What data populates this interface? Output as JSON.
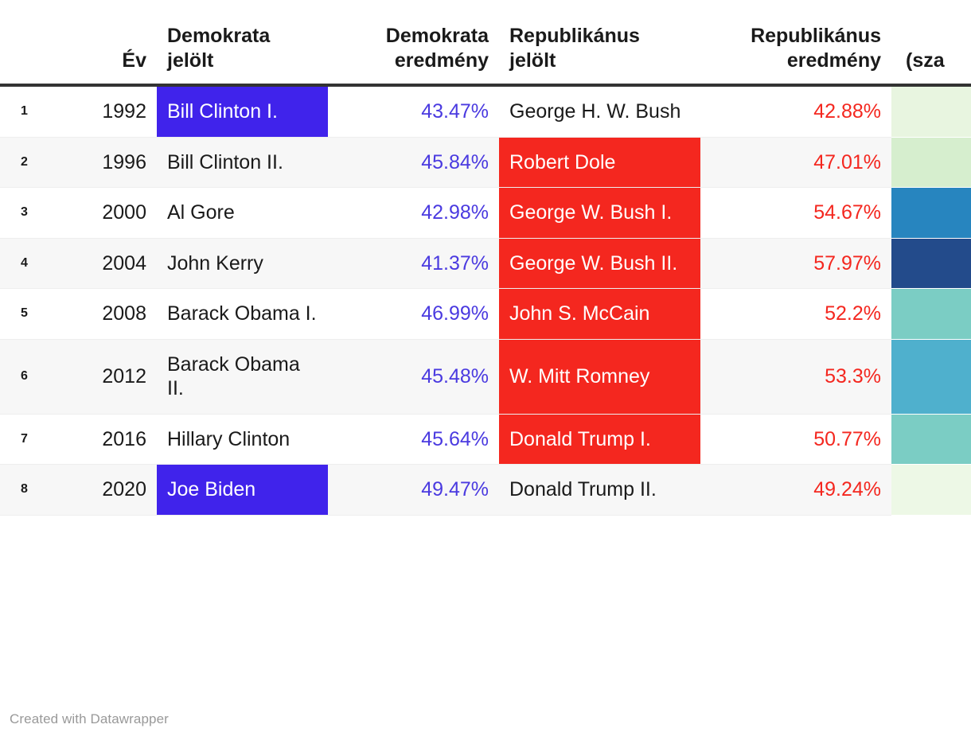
{
  "chart_data": {
    "type": "table",
    "title": "",
    "columns": [
      {
        "key": "index",
        "label": "",
        "align": "left"
      },
      {
        "key": "year",
        "label": "Év",
        "align": "right"
      },
      {
        "key": "dem_cand",
        "label": "Demokrata jelölt",
        "align": "left"
      },
      {
        "key": "dem_result",
        "label": "Demokrata eredmény",
        "align": "right"
      },
      {
        "key": "rep_cand",
        "label": "Republikánus jelölt",
        "align": "left"
      },
      {
        "key": "rep_result",
        "label": "Republikánus eredmény",
        "align": "right"
      },
      {
        "key": "swatch",
        "label": "(sza",
        "align": "left"
      }
    ],
    "rows": [
      {
        "index": "1",
        "year": "1992",
        "dem_cand": "Bill Clinton I.",
        "dem_result": "43.47%",
        "rep_cand": "George H. W. Bush",
        "rep_result": "42.88%",
        "dem_highlight": true,
        "rep_highlight": false,
        "swatch_color": "#e8f5e0"
      },
      {
        "index": "2",
        "year": "1996",
        "dem_cand": "Bill Clinton II.",
        "dem_result": "45.84%",
        "rep_cand": "Robert Dole",
        "rep_result": "47.01%",
        "dem_highlight": false,
        "rep_highlight": true,
        "swatch_color": "#d6eece"
      },
      {
        "index": "3",
        "year": "2000",
        "dem_cand": "Al Gore",
        "dem_result": "42.98%",
        "rep_cand": "George W. Bush I.",
        "rep_result": "54.67%",
        "dem_highlight": false,
        "rep_highlight": true,
        "swatch_color": "#2785bf"
      },
      {
        "index": "4",
        "year": "2004",
        "dem_cand": "John Kerry",
        "dem_result": "41.37%",
        "rep_cand": "George W. Bush II.",
        "rep_result": "57.97%",
        "dem_highlight": false,
        "rep_highlight": true,
        "swatch_color": "#234b8b"
      },
      {
        "index": "5",
        "year": "2008",
        "dem_cand": "Barack Obama I.",
        "dem_result": "46.99%",
        "rep_cand": "John S. McCain",
        "rep_result": "52.2%",
        "dem_highlight": false,
        "rep_highlight": true,
        "swatch_color": "#7bcdc4"
      },
      {
        "index": "6",
        "year": "2012",
        "dem_cand": "Barack Obama II.",
        "dem_result": "45.48%",
        "rep_cand": "W. Mitt Romney",
        "rep_result": "53.3%",
        "dem_highlight": false,
        "rep_highlight": true,
        "swatch_color": "#4fb0cd"
      },
      {
        "index": "7",
        "year": "2016",
        "dem_cand": "Hillary Clinton",
        "dem_result": "45.64%",
        "rep_cand": "Donald Trump I.",
        "rep_result": "50.77%",
        "dem_highlight": false,
        "rep_highlight": true,
        "swatch_color": "#7bcdc4"
      },
      {
        "index": "8",
        "year": "2020",
        "dem_cand": "Joe Biden",
        "dem_result": "49.47%",
        "rep_cand": "Donald Trump II.",
        "rep_result": "49.24%",
        "dem_highlight": true,
        "rep_highlight": false,
        "swatch_color": "#edf8e6"
      }
    ],
    "colors": {
      "democrat_highlight": "#4023eb",
      "republican_highlight": "#f4271f",
      "democrat_text": "#4a3ae0",
      "republican_text": "#f4271f",
      "header_rule": "#333333",
      "alt_row": "#f7f7f7"
    }
  },
  "footer": {
    "credit": "Created with Datawrapper"
  }
}
